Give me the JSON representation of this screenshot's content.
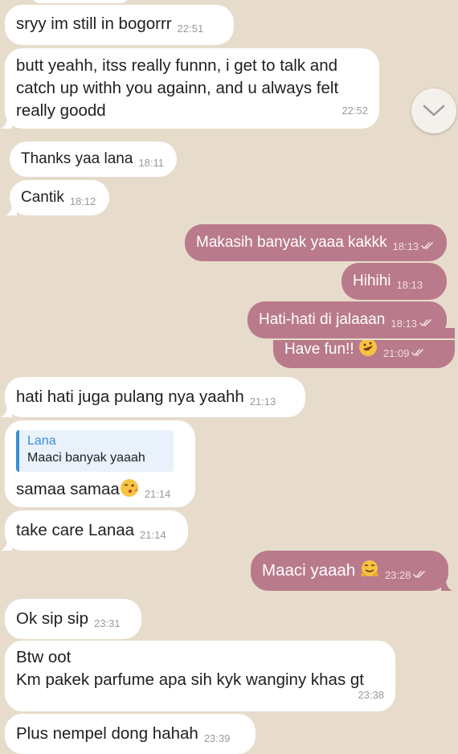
{
  "messages": [
    {
      "dir": "in",
      "text": "sryy im still in bogorrr",
      "time": "22:51"
    },
    {
      "dir": "in",
      "lines": [
        "butt yeahh, itss really funnn, i get to talk and",
        "catch up withh you againn, and u always felt",
        "really goodd"
      ],
      "time": "22:52"
    },
    {
      "dir": "in",
      "text": "Thanks yaa lana",
      "time": "18:11"
    },
    {
      "dir": "in",
      "text": "Cantik",
      "time": "18:12"
    },
    {
      "dir": "out",
      "text": "Makasih banyak yaaa kakkk",
      "time": "18:13"
    },
    {
      "dir": "out",
      "text": "Hihihi",
      "time": "18:13"
    },
    {
      "dir": "out",
      "text": "Hati-hati di jalaaan",
      "time": "18:13"
    },
    {
      "dir": "out",
      "text": "Have fun!!",
      "time": "21:09",
      "emoji": "rofl-emoji"
    },
    {
      "dir": "in",
      "text": "hati hati juga pulang nya yaahh",
      "time": "21:13"
    },
    {
      "dir": "in",
      "reply": {
        "name": "Lana",
        "text": "Maaci banyak yaaah"
      },
      "text": "samaa samaa",
      "time": "21:14",
      "emoji": "kiss-emoji"
    },
    {
      "dir": "in",
      "text": "take care Lanaa",
      "time": "21:14"
    },
    {
      "dir": "out",
      "text": "Maaci yaaah",
      "time": "23:28",
      "emoji": "hug-emoji"
    },
    {
      "dir": "in",
      "text": "Ok sip sip",
      "time": "23:31"
    },
    {
      "dir": "in",
      "lines": [
        "Btw oot",
        "Km pakek parfume apa sih kyk wanginy khas gt"
      ],
      "time": "23:38"
    },
    {
      "dir": "in",
      "text": "Plus nempel dong hahah",
      "time": "23:39"
    }
  ],
  "scroll_button": {
    "icon": "chevron-down-icon"
  },
  "colors": {
    "background": "#e7dccb",
    "incoming_bubble": "#ffffff",
    "outgoing_bubble": "#b97a8c",
    "reply_accent": "#3a8ed6"
  }
}
